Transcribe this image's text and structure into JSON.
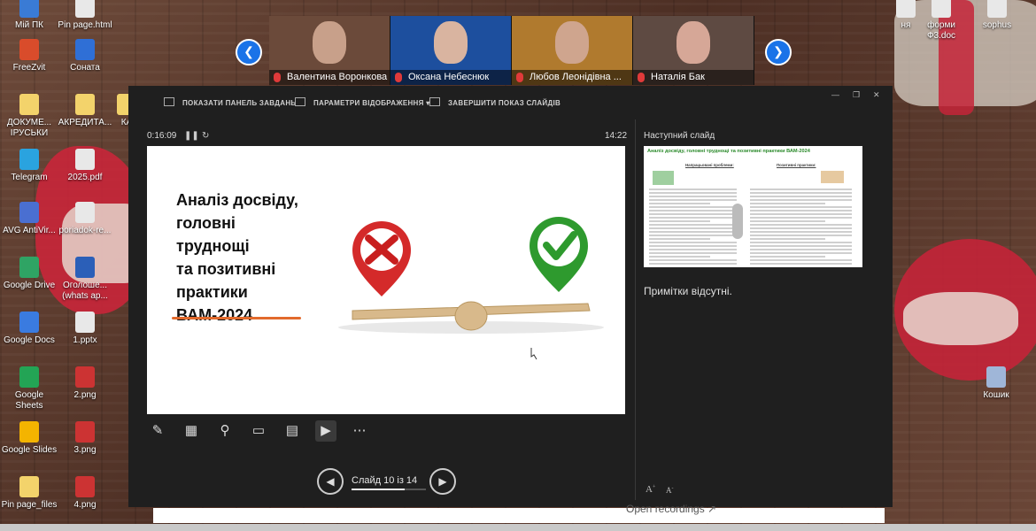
{
  "desktop": {
    "icons_left": [
      {
        "label": "Мій ПК",
        "color": "#3a7bd5"
      },
      {
        "label": "Pin page.html",
        "color": "#e8e8e8"
      },
      {
        "label": "FreeZvit",
        "color": "#d94c2b"
      },
      {
        "label": "Соната",
        "color": "#2f6fd6"
      },
      {
        "label": "ДОКУМЕ... ІРУСЬКИ",
        "color": "#f3d36b"
      },
      {
        "label": "АКРЕДИТА...",
        "color": "#f3d36b"
      },
      {
        "label": "КА",
        "color": "#f3d36b"
      },
      {
        "label": "Telegram",
        "color": "#2aa3df"
      },
      {
        "label": "2025.pdf",
        "color": "#e8e8e8"
      },
      {
        "label": "AVG AntiVir...",
        "color": "#4a6fd1"
      },
      {
        "label": "poriadok-re...",
        "color": "#e8e8e8"
      },
      {
        "label": "Google Drive",
        "color": "#2fa464"
      },
      {
        "label": "Оголоше... (whats ap...",
        "color": "#2b5fb8"
      },
      {
        "label": "Google Docs",
        "color": "#3a7be0"
      },
      {
        "label": "1.pptx",
        "color": "#e8e8e8"
      },
      {
        "label": "Google Sheets",
        "color": "#23a455"
      },
      {
        "label": "2.png",
        "color": "#cc3333"
      },
      {
        "label": "Google Slides",
        "color": "#f4b400"
      },
      {
        "label": "3.png",
        "color": "#cc3333"
      },
      {
        "label": "Pin page_files",
        "color": "#f3d36b"
      },
      {
        "label": "4.png",
        "color": "#cc3333"
      }
    ],
    "icons_right": [
      {
        "label": "ня",
        "color": "#e8e8e8"
      },
      {
        "label": "форми Ф3.doc",
        "color": "#e8e8e8"
      },
      {
        "label": "sophus",
        "color": "#e8e8e8"
      },
      {
        "label": "Кошик",
        "color": "#9fb6d8"
      }
    ]
  },
  "participants": [
    {
      "name": "Валентина Воронкова",
      "bg": "#6b4a3a",
      "face": "#c8a08a",
      "muted": true
    },
    {
      "name": "Оксана Небеснюк",
      "bg": "#1d4f9e",
      "face": "#d9b4a0",
      "muted": true
    },
    {
      "name": "Любов Леонідівна ...",
      "bg": "#b07a2e",
      "face": "#cfa58e",
      "muted": true
    },
    {
      "name": "Наталія Бак",
      "bg": "#5e4a42",
      "face": "#d6a797",
      "muted": true
    }
  ],
  "toolbar": {
    "show_taskbar": "ПОКАЗАТИ ПАНЕЛЬ ЗАВДАНЬ",
    "display_settings": "ПАРАМЕТРИ ВІДОБРАЖЕННЯ ▾",
    "end_show": "ЗАВЕРШИТИ ПОКАЗ СЛАЙДІВ"
  },
  "window_controls": {
    "minimize": "―",
    "restore": "❐",
    "close": "✕"
  },
  "presenter": {
    "elapsed": "0:16:09",
    "clock": "14:22",
    "next_slide_label": "Наступний слайд",
    "notes": "Примітки відсутні.",
    "slide_counter": "Слайд 10 із 14",
    "current_slide": 10,
    "total_slides": 14
  },
  "slide": {
    "title": "Аналіз досвіду,\nголовні\nтруднощі\nта позитивні\nпрактики\nВАМ-2024",
    "accent": "#e26a2c"
  },
  "next_slide": {
    "title": "Аналіз досвіду, головні труднощі та позитивні практики ВАМ-2024",
    "left_heading": "Напрацьовані проблеми:",
    "right_heading": "Позитивні практики:"
  },
  "bottom_text": "Open recordings ↗"
}
